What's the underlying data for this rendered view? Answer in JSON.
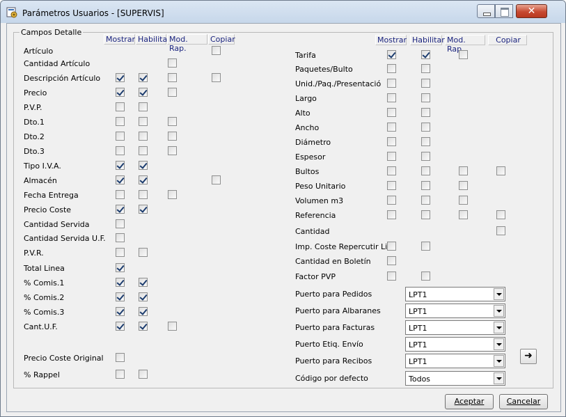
{
  "window": {
    "title": "Parámetros Usuarios - [SUPERVIS]",
    "close_glyph": "✕"
  },
  "group": {
    "legend": "Campos Detalle"
  },
  "headers": {
    "mostrar": "Mostrar",
    "habilitar": "Habilitar",
    "mod_rap": "Mod. Rap.",
    "copiar": "Copiar"
  },
  "left_fields": [
    {
      "label": "Artículo",
      "mostrar": null,
      "habilitar": null,
      "mod_rap": null,
      "copiar": false
    },
    {
      "label": "Cantidad Artículo",
      "mostrar": null,
      "habilitar": null,
      "mod_rap": false,
      "copiar": null
    },
    {
      "label": "Descripción Artículo",
      "mostrar": true,
      "habilitar": true,
      "mod_rap": false,
      "copiar": false
    },
    {
      "label": "Precio",
      "mostrar": true,
      "habilitar": true,
      "mod_rap": false,
      "copiar": null
    },
    {
      "label": "P.V.P.",
      "mostrar": false,
      "habilitar": false,
      "mod_rap": null,
      "copiar": null
    },
    {
      "label": "Dto.1",
      "mostrar": false,
      "habilitar": false,
      "mod_rap": false,
      "copiar": null
    },
    {
      "label": "Dto.2",
      "mostrar": false,
      "habilitar": false,
      "mod_rap": false,
      "copiar": null
    },
    {
      "label": "Dto.3",
      "mostrar": false,
      "habilitar": false,
      "mod_rap": false,
      "copiar": null
    },
    {
      "label": "Tipo I.V.A.",
      "mostrar": true,
      "habilitar": true,
      "mod_rap": null,
      "copiar": null
    },
    {
      "label": "Almacén",
      "mostrar": true,
      "habilitar": true,
      "mod_rap": null,
      "copiar": false
    },
    {
      "label": "Fecha Entrega",
      "mostrar": false,
      "habilitar": false,
      "mod_rap": false,
      "copiar": null
    },
    {
      "label": "Precio Coste",
      "mostrar": true,
      "habilitar": true,
      "mod_rap": null,
      "copiar": null
    },
    {
      "label": "Cantidad Servida",
      "mostrar": false,
      "habilitar": null,
      "mod_rap": null,
      "copiar": null
    },
    {
      "label": "Cantidad Servida U.F.",
      "mostrar": false,
      "habilitar": null,
      "mod_rap": null,
      "copiar": null
    },
    {
      "label": "P.V.R.",
      "mostrar": false,
      "habilitar": false,
      "mod_rap": null,
      "copiar": null
    },
    {
      "label": "Total Linea",
      "mostrar": true,
      "habilitar": null,
      "mod_rap": null,
      "copiar": null
    },
    {
      "label": "% Comis.1",
      "mostrar": true,
      "habilitar": true,
      "mod_rap": null,
      "copiar": null
    },
    {
      "label": "% Comis.2",
      "mostrar": true,
      "habilitar": true,
      "mod_rap": null,
      "copiar": null
    },
    {
      "label": "% Comis.3",
      "mostrar": true,
      "habilitar": true,
      "mod_rap": null,
      "copiar": null
    },
    {
      "label": "Cant.U.F.",
      "mostrar": true,
      "habilitar": true,
      "mod_rap": false,
      "copiar": null
    },
    {
      "label": "Precio Coste Original",
      "mostrar": false,
      "habilitar": null,
      "mod_rap": null,
      "copiar": null
    },
    {
      "label": "% Rappel",
      "mostrar": false,
      "habilitar": false,
      "mod_rap": null,
      "copiar": null
    }
  ],
  "right_fields": [
    {
      "label": "Tarifa",
      "mostrar": true,
      "habilitar": true,
      "mod_rap": false,
      "copiar": null
    },
    {
      "label": "Paquetes/Bulto",
      "mostrar": false,
      "habilitar": false,
      "mod_rap": null,
      "copiar": null
    },
    {
      "label": "Unid./Paq./Presentació",
      "mostrar": false,
      "habilitar": false,
      "mod_rap": null,
      "copiar": null
    },
    {
      "label": "Largo",
      "mostrar": false,
      "habilitar": false,
      "mod_rap": null,
      "copiar": null
    },
    {
      "label": "Alto",
      "mostrar": false,
      "habilitar": false,
      "mod_rap": null,
      "copiar": null
    },
    {
      "label": "Ancho",
      "mostrar": false,
      "habilitar": false,
      "mod_rap": null,
      "copiar": null
    },
    {
      "label": "Diámetro",
      "mostrar": false,
      "habilitar": false,
      "mod_rap": null,
      "copiar": null
    },
    {
      "label": "Espesor",
      "mostrar": false,
      "habilitar": false,
      "mod_rap": null,
      "copiar": null
    },
    {
      "label": "Bultos",
      "mostrar": false,
      "habilitar": false,
      "mod_rap": false,
      "copiar": false
    },
    {
      "label": "Peso Unitario",
      "mostrar": false,
      "habilitar": false,
      "mod_rap": false,
      "copiar": null
    },
    {
      "label": "Volumen m3",
      "mostrar": false,
      "habilitar": false,
      "mod_rap": false,
      "copiar": null
    },
    {
      "label": "Referencia",
      "mostrar": false,
      "habilitar": false,
      "mod_rap": false,
      "copiar": false
    },
    {
      "label": "Cantidad",
      "mostrar": null,
      "habilitar": null,
      "mod_rap": null,
      "copiar": false
    },
    {
      "label": "Imp. Coste Repercutir Lin.",
      "mostrar": false,
      "habilitar": false,
      "mod_rap": null,
      "copiar": null
    },
    {
      "label": "Cantidad en Boletín",
      "mostrar": false,
      "habilitar": null,
      "mod_rap": null,
      "copiar": null
    },
    {
      "label": "Factor PVP",
      "mostrar": false,
      "habilitar": false,
      "mod_rap": null,
      "copiar": null
    }
  ],
  "ports": [
    {
      "label": "Puerto para Pedidos",
      "value": "LPT1"
    },
    {
      "label": "Puerto para Albaranes",
      "value": "LPT1"
    },
    {
      "label": "Puerto para Facturas",
      "value": "LPT1"
    },
    {
      "label": "Puerto Etiq. Envío",
      "value": "LPT1"
    },
    {
      "label": "Puerto para Recibos",
      "value": "LPT1"
    },
    {
      "label": "Código por defecto",
      "value": "Todos"
    }
  ],
  "side_button": {
    "icon": "arrow-right-icon",
    "glyph": "➜"
  },
  "buttons": {
    "accept": "Aceptar",
    "cancel": "Cancelar"
  }
}
